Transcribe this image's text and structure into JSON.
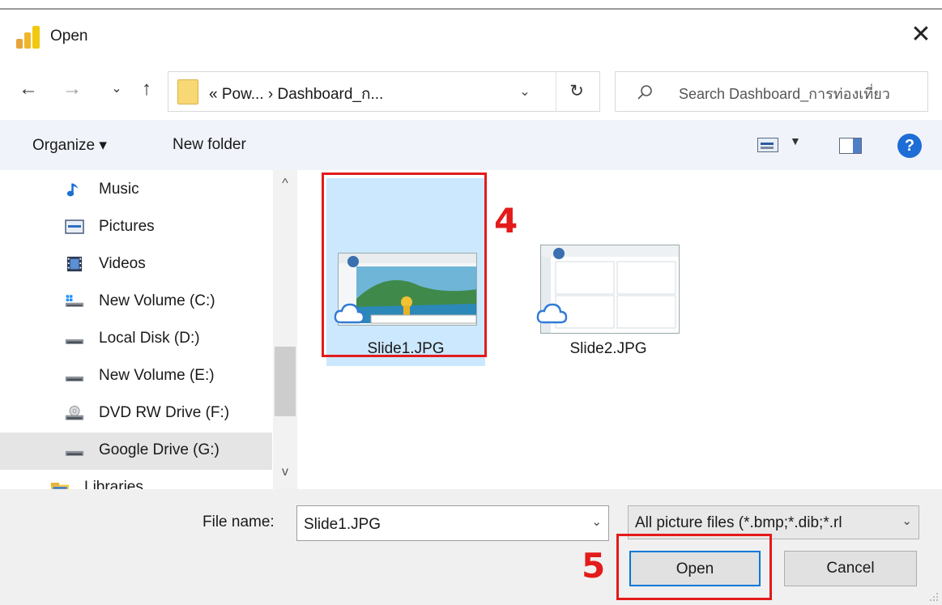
{
  "window": {
    "title": "Open",
    "close_glyph": "✕"
  },
  "nav": {
    "back_glyph": "←",
    "forward_glyph": "→",
    "recent_glyph": "⌄",
    "up_glyph": "↑",
    "breadcrumb": "«  Pow...  ›  Dashboard_ก...",
    "breadcrumb_dropdown_glyph": "⌄",
    "refresh_glyph": "↻",
    "search_placeholder": "Search Dashboard_การท่องเที่ยว"
  },
  "toolbar": {
    "organize_label": "Organize ▾",
    "new_folder_label": "New folder",
    "view_dropdown_glyph": "▼",
    "help_glyph": "?"
  },
  "sidebar": {
    "items": [
      {
        "label": "Music",
        "icon": "music-icon"
      },
      {
        "label": "Pictures",
        "icon": "pictures-icon"
      },
      {
        "label": "Videos",
        "icon": "videos-icon"
      },
      {
        "label": "New Volume (C:)",
        "icon": "windows-drive-icon"
      },
      {
        "label": "Local Disk (D:)",
        "icon": "drive-icon"
      },
      {
        "label": "New Volume (E:)",
        "icon": "drive-icon"
      },
      {
        "label": "DVD RW Drive (F:)",
        "icon": "dvd-drive-icon"
      },
      {
        "label": "Google Drive (G:)",
        "icon": "drive-icon"
      },
      {
        "label": "Libraries",
        "icon": "libraries-icon"
      }
    ],
    "scroll_up_glyph": "^",
    "scroll_down_glyph": "v"
  },
  "files": [
    {
      "name": "Slide1.JPG",
      "selected": true
    },
    {
      "name": "Slide2.JPG",
      "selected": false
    }
  ],
  "annotations": {
    "step_file": "4",
    "step_open": "5"
  },
  "footer": {
    "file_name_label": "File name:",
    "file_name_value": "Slide1.JPG",
    "file_name_dropdown_glyph": "⌄",
    "file_type_value": "All picture files (*.bmp;*.dib;*.rl",
    "file_type_dropdown_glyph": "⌄",
    "open_label": "Open",
    "cancel_label": "Cancel"
  },
  "colors": {
    "accent": "#0078d7",
    "annotation_red": "#e31b1b",
    "selection": "#cce8ff"
  }
}
